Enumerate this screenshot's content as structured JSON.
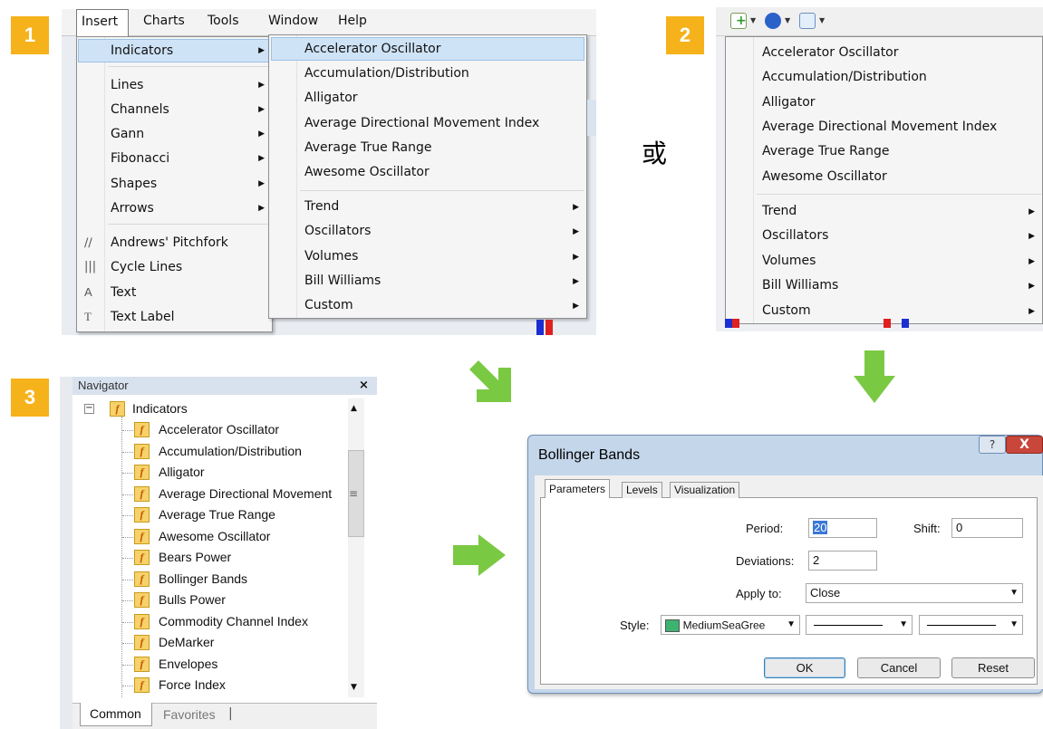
{
  "steps": [
    "1",
    "2",
    "3"
  ],
  "or_text": "或",
  "menubar": {
    "items": [
      "Insert",
      "Charts",
      "Tools",
      "Window",
      "Help"
    ]
  },
  "insert_menu": {
    "items": [
      {
        "label": "Indicators",
        "icon": ""
      },
      {
        "label": "Lines",
        "icon": ""
      },
      {
        "label": "Channels",
        "icon": ""
      },
      {
        "label": "Gann",
        "icon": ""
      },
      {
        "label": "Fibonacci",
        "icon": ""
      },
      {
        "label": "Shapes",
        "icon": ""
      },
      {
        "label": "Arrows",
        "icon": ""
      },
      {
        "label": "Andrews' Pitchfork",
        "icon": "pitchfork-icon"
      },
      {
        "label": "Cycle Lines",
        "icon": "cycle-lines-icon"
      },
      {
        "label": "Text",
        "icon": "text-icon"
      },
      {
        "label": "Text Label",
        "icon": "text-label-icon"
      }
    ]
  },
  "indicators_menu": {
    "items": [
      "Accelerator Oscillator",
      "Accumulation/Distribution",
      "Alligator",
      "Average Directional Movement Index",
      "Average True Range",
      "Awesome Oscillator"
    ],
    "submenus": [
      "Trend",
      "Oscillators",
      "Volumes",
      "Bill Williams",
      "Custom"
    ]
  },
  "toolbar_menu": {
    "items": [
      "Accelerator Oscillator",
      "Accumulation/Distribution",
      "Alligator",
      "Average Directional Movement Index",
      "Average True Range",
      "Awesome Oscillator"
    ],
    "submenus": [
      "Trend",
      "Oscillators",
      "Volumes",
      "Bill Williams",
      "Custom"
    ]
  },
  "navigator": {
    "title": "Navigator",
    "close": "×",
    "root": "Indicators",
    "items": [
      "Accelerator Oscillator",
      "Accumulation/Distribution",
      "Alligator",
      "Average Directional Movement",
      "Average True Range",
      "Awesome Oscillator",
      "Bears Power",
      "Bollinger Bands",
      "Bulls Power",
      "Commodity Channel Index",
      "DeMarker",
      "Envelopes",
      "Force Index"
    ],
    "tabs": [
      "Common",
      "Favorites"
    ]
  },
  "dialog": {
    "title": "Bollinger Bands",
    "help": "?",
    "close": "X",
    "tabs": [
      "Parameters",
      "Levels",
      "Visualization"
    ],
    "period_label": "Period:",
    "period_value": "20",
    "shift_label": "Shift:",
    "shift_value": "0",
    "deviations_label": "Deviations:",
    "deviations_value": "2",
    "apply_label": "Apply to:",
    "apply_value": "Close",
    "style_label": "Style:",
    "style_color": "MediumSeaGree",
    "style_swatch": "#3cb371",
    "buttons": {
      "ok": "OK",
      "cancel": "Cancel",
      "reset": "Reset"
    }
  },
  "colors": {
    "step_badge": "#f6b21a",
    "arrow": "#7ac943",
    "highlight": "#cfe3f7"
  }
}
